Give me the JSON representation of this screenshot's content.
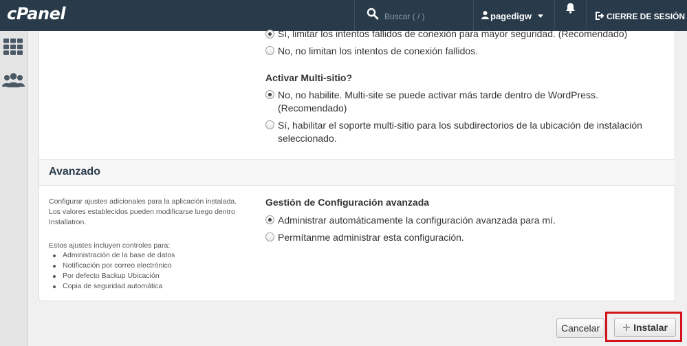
{
  "header": {
    "logo": "cPanel",
    "search_placeholder": "Buscar ( / )",
    "username": "pagedigw",
    "logout_label": "CIERRE DE SESIÓN"
  },
  "sidebar": {
    "icons": [
      "grid-icon",
      "users-icon"
    ]
  },
  "login_limit": {
    "options": [
      "Sí, limitar los intentos fallidos de conexión para mayor seguridad. (Recomendado)",
      "No, no limitan los intentos de conexión fallidos."
    ],
    "selected_index": 0
  },
  "multisite": {
    "heading": "Activar Multi-sitio?",
    "options": [
      {
        "line1": "No, no habilite. Multi-site se puede activar más tarde dentro de WordPress.",
        "line2": "(Recomendado)"
      },
      {
        "line1": "Sí, habilitar el soporte multi-sitio para los subdirectorios de la ubicación de instalación",
        "line2": "seleccionado."
      }
    ],
    "selected_index": 0
  },
  "advanced": {
    "title": "Avanzado",
    "description": "Configurar ajustes adicionales para la aplicación instalada. Los valores establecidos pueden modificarse luego dentro Installatron.",
    "controls_intro": "Estos ajustes incluyen controles para:",
    "controls": [
      "Administración de la base de datos",
      "Notificación por correo electrónico",
      "Por defecto Backup Ubicación",
      "Copia de seguridad automática"
    ],
    "config_heading": "Gestión de Configuración avanzada",
    "config_options": [
      "Administrar automáticamente la configuración avanzada para mí.",
      "Permítanme administrar esta configuración."
    ],
    "selected_index": 0
  },
  "actions": {
    "cancel_label": "Cancelar",
    "install_label": "Instalar"
  },
  "colors": {
    "topbar": "#293a4a",
    "highlight": "#d4141c"
  }
}
